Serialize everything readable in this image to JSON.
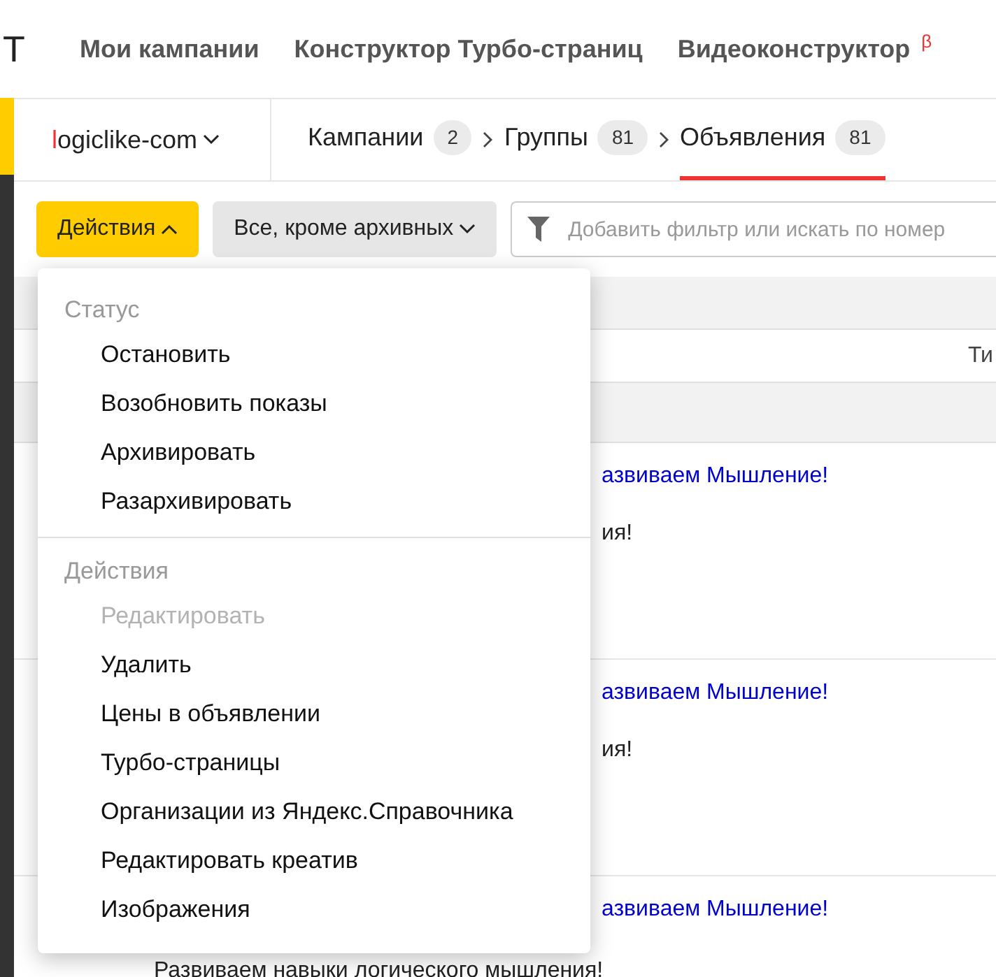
{
  "logo_fragment": "Т",
  "nav": [
    {
      "label": "Мои кампании"
    },
    {
      "label": "Конструктор Турбо-страниц"
    },
    {
      "label": "Видеоконструктор",
      "badge": "β"
    }
  ],
  "account": "logiclike-com",
  "breadcrumbs": [
    {
      "label": "Кампании",
      "count": "2",
      "selected": false
    },
    {
      "label": "Группы",
      "count": "81",
      "selected": false
    },
    {
      "label": "Объявления",
      "count": "81",
      "selected": true
    }
  ],
  "toolbar": {
    "actions_button": "Действия",
    "expanded": true,
    "status_filter": "Все, кроме архивных",
    "search": {
      "placeholder": "Добавить фильтр или искать по номер"
    }
  },
  "table": {
    "column_fragment": "Ти",
    "rows": [
      {
        "title": "азвиваем Мышление!",
        "text": "ия!"
      },
      {
        "title": "азвиваем Мышление!",
        "text": "ия!"
      },
      {
        "title": "азвиваем Мышление!",
        "text": "Развиваем навыки логического мышления!"
      }
    ]
  },
  "menu": {
    "sections": [
      {
        "header": "Статус",
        "items": [
          {
            "label": "Остановить",
            "disabled": false
          },
          {
            "label": "Возобновить показы",
            "disabled": false
          },
          {
            "label": "Архивировать",
            "disabled": false
          },
          {
            "label": "Разархивировать",
            "disabled": false
          }
        ]
      },
      {
        "header": "Действия",
        "items": [
          {
            "label": "Редактировать",
            "disabled": true
          },
          {
            "label": "Удалить",
            "disabled": false
          },
          {
            "label": "Цены в объявлении",
            "disabled": false
          },
          {
            "label": "Турбо-страницы",
            "disabled": false
          },
          {
            "label": "Организации из Яндекс.Справочника",
            "disabled": false
          },
          {
            "label": "Редактировать креатив",
            "disabled": false
          },
          {
            "label": "Изображения",
            "disabled": false
          }
        ]
      }
    ]
  }
}
